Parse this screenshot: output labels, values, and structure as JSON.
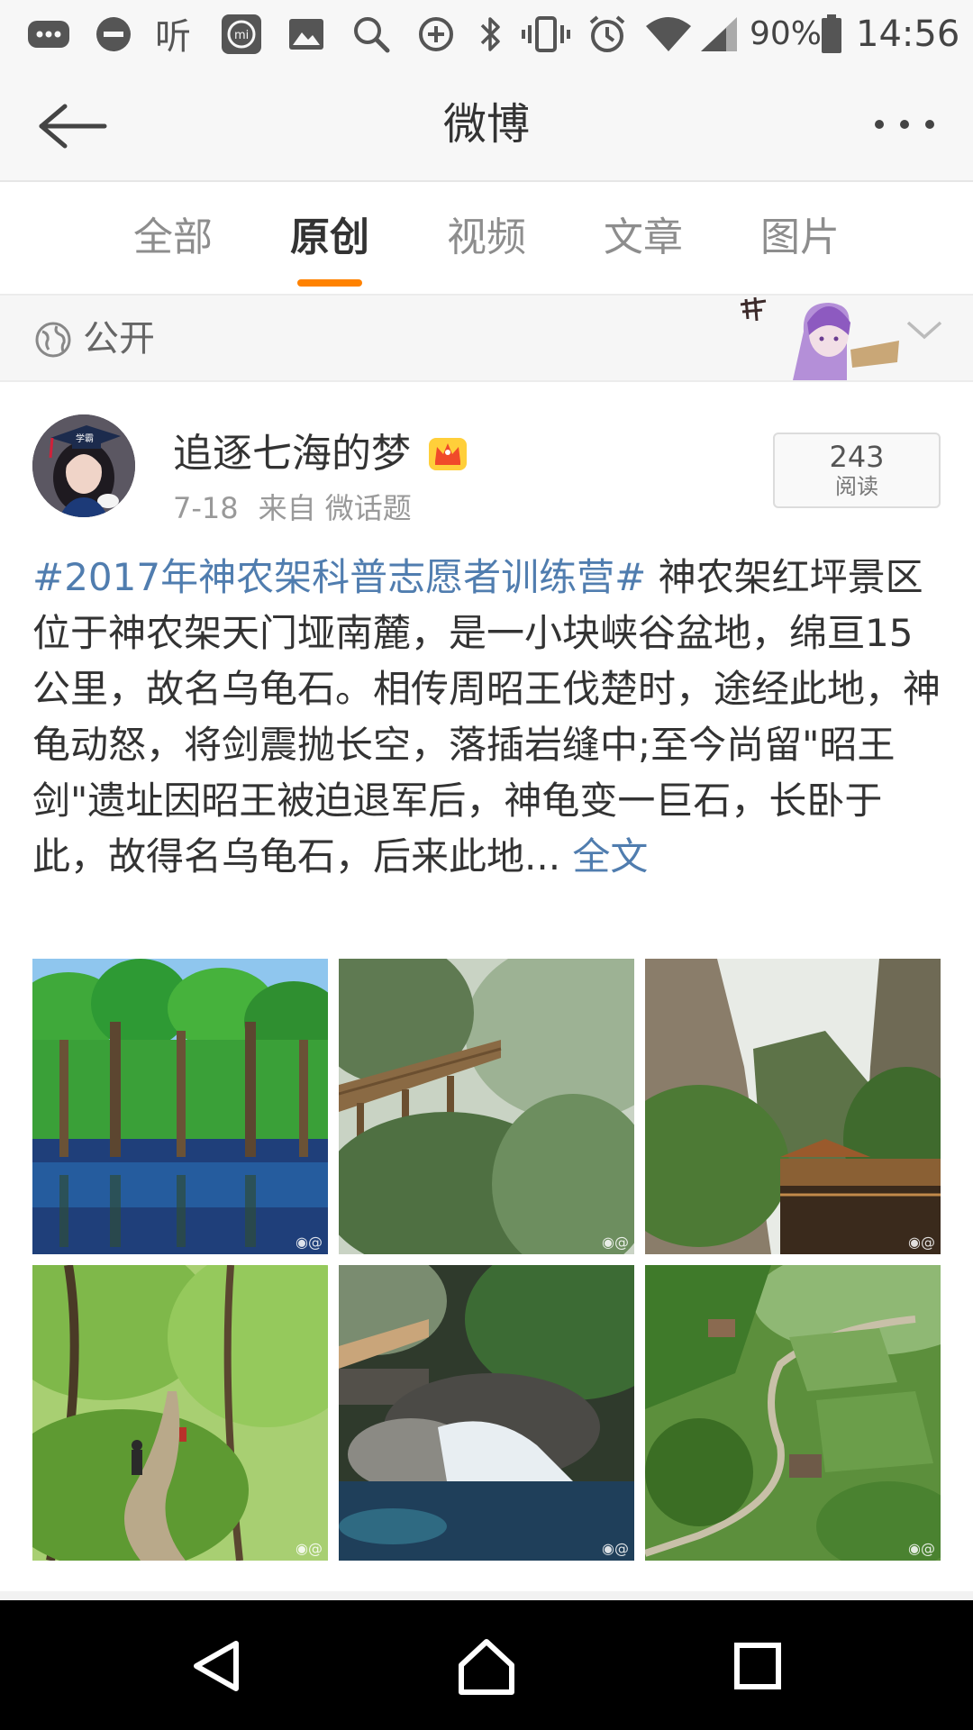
{
  "status_bar": {
    "battery": "90%",
    "time": "14:56"
  },
  "nav": {
    "title": "微博",
    "back_icon": "back-arrow-icon",
    "more_icon": "more-dots-icon"
  },
  "tabs": [
    {
      "label": "全部",
      "active": false
    },
    {
      "label": "原创",
      "active": true
    },
    {
      "label": "视频",
      "active": false
    },
    {
      "label": "文章",
      "active": false
    },
    {
      "label": "图片",
      "active": false
    }
  ],
  "accent_color": "#ff8200",
  "link_color": "#507daf",
  "visibility": {
    "label": "公开",
    "icon": "globe-icon"
  },
  "post": {
    "username": "追逐七海的梦",
    "badge_icon": "crown-icon",
    "date": "7-18",
    "source": "来自 微话题",
    "read_count": "243",
    "read_label": "阅读",
    "topic": "#2017年神农架科普志愿者训练营#",
    "text_after_topic": " 神农架红坪景区",
    "body": "位于神农架天门垭南麓，是一小块峡谷盆地，绵亘15公里，故名乌龟石。相传周昭王伐楚时，途经此地，神龟动怒，将剑震抛长空，落插岩缝中;至今尚留\"昭王剑\"遗址因昭王被迫退军后，神龟变一巨石，长卧于此，故得名乌龟石，后来此地...",
    "full_text_link": " 全文",
    "photos": [
      {
        "subject": "cypress-forest-lake"
      },
      {
        "subject": "misty-cliff-boardwalk"
      },
      {
        "subject": "karst-cliffs-pavilion"
      },
      {
        "subject": "forest-path-hikers"
      },
      {
        "subject": "gorge-stream-rocks"
      },
      {
        "subject": "terraced-village-road"
      }
    ]
  },
  "system_nav": {
    "back_icon": "triangle-back-icon",
    "home_icon": "home-icon",
    "recents_icon": "square-recents-icon"
  }
}
